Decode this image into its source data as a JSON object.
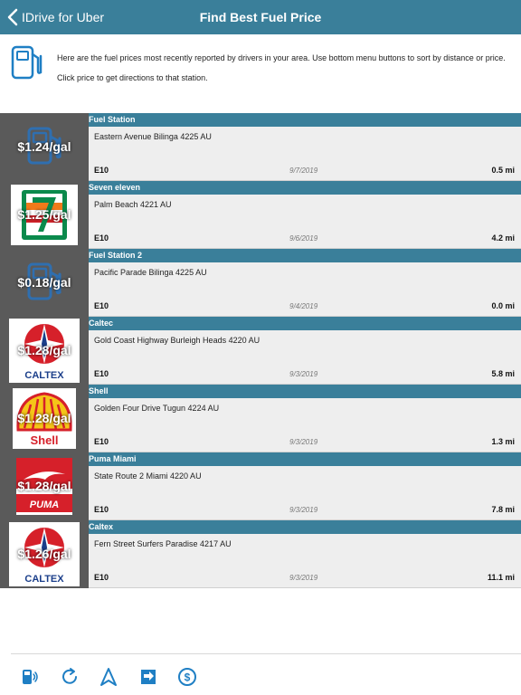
{
  "navbar": {
    "back_label": "IDrive for Uber",
    "title": "Find Best Fuel Price"
  },
  "info": {
    "line1": "Here are the fuel prices most recently reported by drivers in your area. Use bottom menu buttons to sort by distance or price.",
    "line2": "Click price to get directions to that station."
  },
  "stations": [
    {
      "name": "Fuel Station",
      "address": "Eastern Avenue Bilinga  4225 AU",
      "price": "$1.24/gal",
      "fuel": "E10",
      "date": "9/7/2019",
      "distance": "0.5 mi",
      "logo": "fuel-pump-icon"
    },
    {
      "name": "Seven eleven",
      "address": " Palm Beach  4221 AU",
      "price": "$1.25/gal",
      "fuel": "E10",
      "date": "9/6/2019",
      "distance": "4.2 mi",
      "logo": "seven-eleven-logo"
    },
    {
      "name": "Fuel Station 2",
      "address": "Pacific Parade Bilinga  4225 AU",
      "price": "$0.18/gal",
      "fuel": "E10",
      "date": "9/4/2019",
      "distance": "0.0 mi",
      "logo": "fuel-pump-icon"
    },
    {
      "name": "Caltec",
      "address": "Gold Coast Highway Burleigh Heads  4220 AU",
      "price": "$1.28/gal",
      "fuel": "E10",
      "date": "9/3/2019",
      "distance": "5.8 mi",
      "logo": "caltex-logo",
      "logo_text": "CALTEX"
    },
    {
      "name": "Shell",
      "address": "Golden Four Drive Tugun  4224 AU",
      "price": "$1.28/gal",
      "fuel": "E10",
      "date": "9/3/2019",
      "distance": "1.3 mi",
      "logo": "shell-logo",
      "logo_text": "Shell"
    },
    {
      "name": "Puma Miami",
      "address": "State Route 2 Miami  4220 AU",
      "price": "$1.28/gal",
      "fuel": "E10",
      "date": "9/3/2019",
      "distance": "7.8 mi",
      "logo": "puma-logo",
      "logo_text": "PUMA"
    },
    {
      "name": "Caltex",
      "address": "Fern Street Surfers Paradise  4217 AU",
      "price": "$1.26/gal",
      "fuel": "E10",
      "date": "9/3/2019",
      "distance": "11.1 mi",
      "logo": "caltex-logo",
      "logo_text": "CALTEX"
    }
  ],
  "toolbar": {
    "buttons": [
      "report-price-icon",
      "refresh-icon",
      "navigate-icon",
      "sort-distance-icon",
      "sort-price-icon"
    ]
  },
  "colors": {
    "accent": "#3a7f9a",
    "icon_blue": "#1f7fc4",
    "row_bg": "#eeeeee",
    "thumb_bg": "#5a5a5a"
  }
}
